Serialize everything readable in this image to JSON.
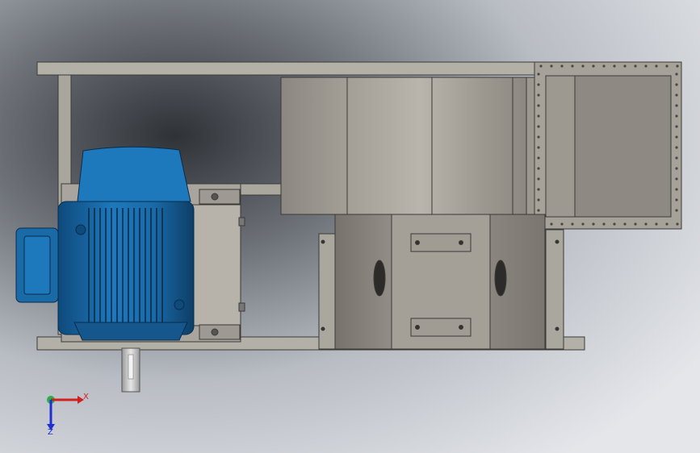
{
  "viewport": {
    "background_gradient": [
      "#3a3d42",
      "#8a8e95",
      "#c9ccd2",
      "#dfe1e6"
    ]
  },
  "model": {
    "frame_color": "#b3b0a8",
    "frame_edge": "#3b3a37",
    "motor_color": "#1b6aa8",
    "motor_dark": "#0d3e66",
    "housing_color": "#9b968e",
    "housing_dark": "#6d6962",
    "flange_color": "#a9a59e",
    "shaft_color": "#c8c8c8"
  },
  "triad": {
    "x_label": "X",
    "z_label": "Z",
    "x_color": "#d21f1f",
    "y_color": "#22b14c",
    "z_color": "#1f2fd2"
  }
}
